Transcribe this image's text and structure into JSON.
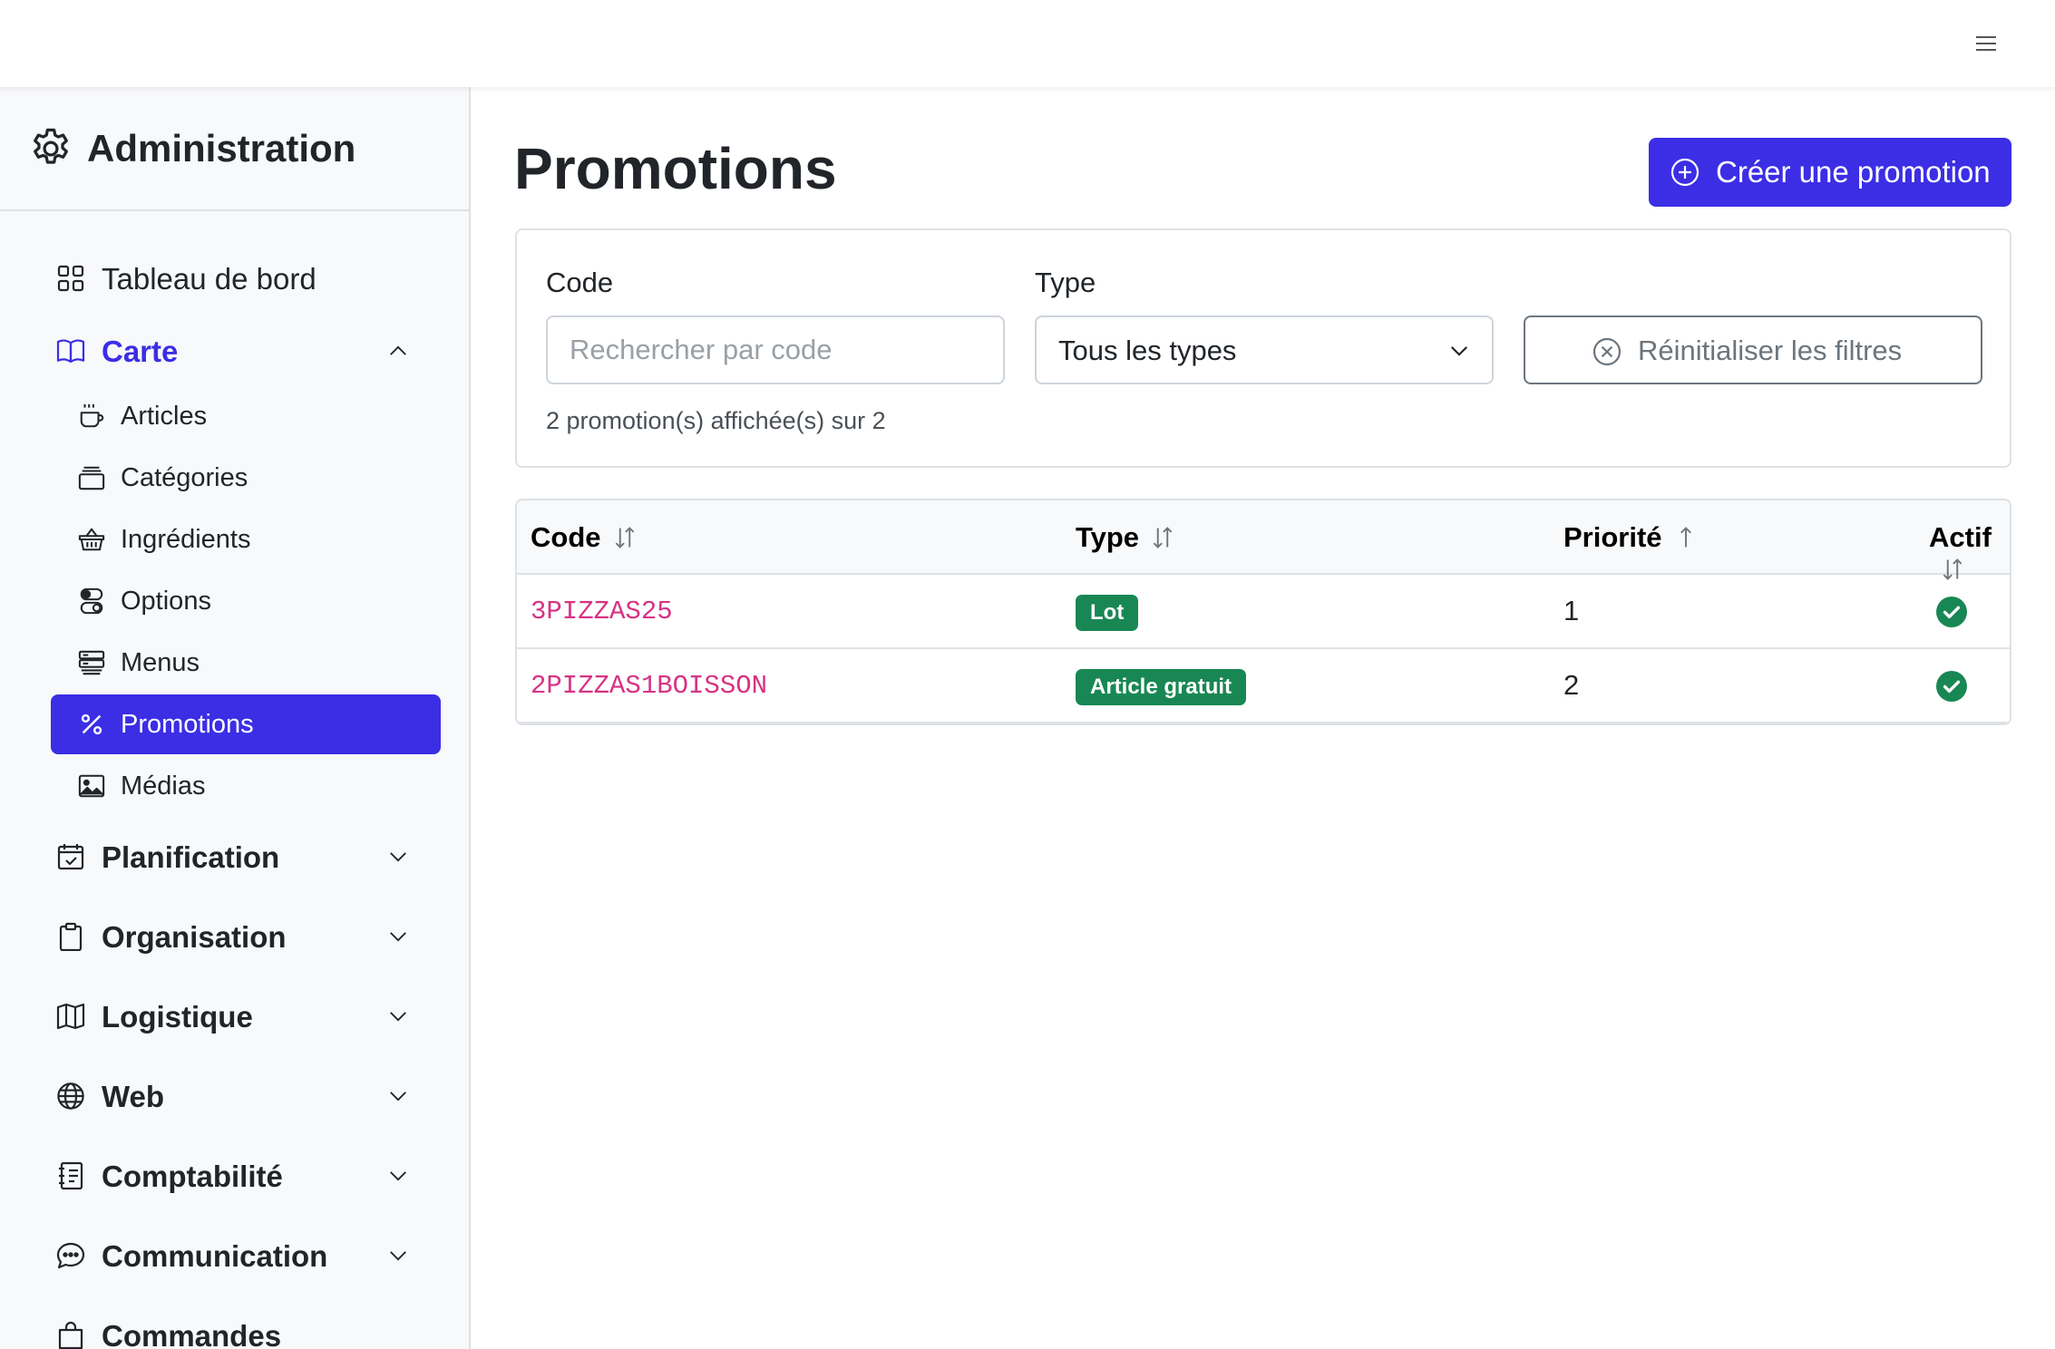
{
  "topbar": {
    "menu_icon": "hamburger-icon"
  },
  "sidebar": {
    "title": "Administration",
    "title_icon": "gear-icon",
    "items": [
      {
        "label": "Tableau de bord",
        "icon": "dashboard-grid-icon"
      },
      {
        "label": "Carte",
        "icon": "book-icon",
        "expanded": true,
        "children": [
          {
            "label": "Articles",
            "icon": "cup-icon"
          },
          {
            "label": "Catégories",
            "icon": "collection-icon"
          },
          {
            "label": "Ingrédients",
            "icon": "basket-icon"
          },
          {
            "label": "Options",
            "icon": "toggles-icon"
          },
          {
            "label": "Menus",
            "icon": "stack-icon"
          },
          {
            "label": "Promotions",
            "icon": "percent-icon",
            "active": true
          },
          {
            "label": "Médias",
            "icon": "image-icon"
          }
        ]
      },
      {
        "label": "Planification",
        "icon": "calendar-check-icon"
      },
      {
        "label": "Organisation",
        "icon": "clipboard-icon"
      },
      {
        "label": "Logistique",
        "icon": "map-icon"
      },
      {
        "label": "Web",
        "icon": "globe-icon"
      },
      {
        "label": "Comptabilité",
        "icon": "journal-icon"
      },
      {
        "label": "Communication",
        "icon": "chat-icon"
      },
      {
        "label": "Commandes",
        "icon": "bag-icon"
      }
    ]
  },
  "main": {
    "title": "Promotions",
    "create_button": "Créer une promotion",
    "filters": {
      "code_label": "Code",
      "code_placeholder": "Rechercher par code",
      "code_value": "",
      "type_label": "Type",
      "type_value": "Tous les types",
      "reset_button": "Réinitialiser les filtres",
      "count_text": "2 promotion(s) affichée(s) sur 2"
    },
    "table": {
      "columns": [
        "Code",
        "Type",
        "Priorité",
        "Actif"
      ],
      "rows": [
        {
          "code": "3PIZZAS25",
          "type": "Lot",
          "priority": "1",
          "active": true
        },
        {
          "code": "2PIZZAS1BOISSON",
          "type": "Article gratuit",
          "priority": "2",
          "active": true
        }
      ]
    }
  },
  "colors": {
    "accent": "#3b2ee5",
    "badge": "#198754",
    "code": "#d63384"
  }
}
